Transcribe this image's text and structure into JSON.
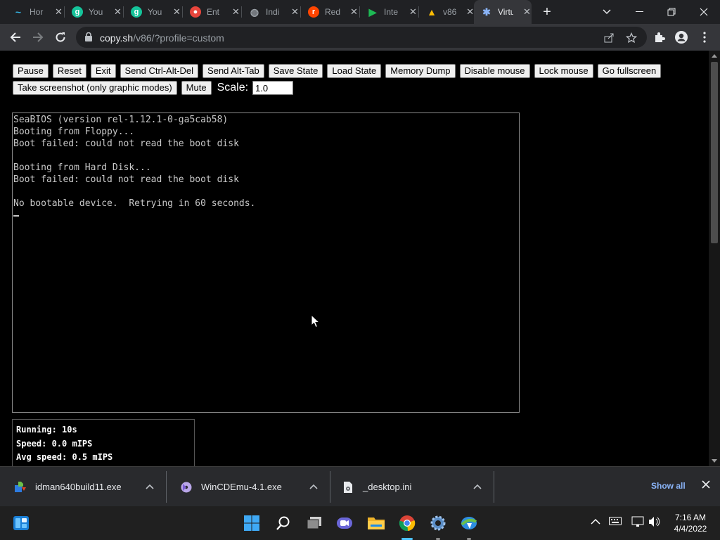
{
  "browser": {
    "tabs": [
      {
        "label": "Hor",
        "icon": "wave-favicon-icon",
        "color": "#35b6e6"
      },
      {
        "label": "You",
        "icon": "grammarly-g-icon",
        "color": "#15c39a"
      },
      {
        "label": "You",
        "icon": "grammarly-g-icon",
        "color": "#15c39a"
      },
      {
        "label": "Ent",
        "icon": "colorful-logo-icon",
        "color": "#e8453c"
      },
      {
        "label": "Indi",
        "icon": "globe-icon",
        "color": "#9aa0a6"
      },
      {
        "label": "Red",
        "icon": "reddit-icon",
        "color": "#ff4500"
      },
      {
        "label": "Inte",
        "icon": "green-flag-icon",
        "color": "#1db954"
      },
      {
        "label": "v86",
        "icon": "google-drive-icon",
        "color": "#fbbc04"
      },
      {
        "label": "Virtu",
        "icon": "v86-logo-icon",
        "color": "#8ab4f8"
      }
    ],
    "new_tab": "+",
    "url_host": "copy.sh",
    "url_path": "/v86/?profile=custom"
  },
  "buttons_row1": [
    "Pause",
    "Reset",
    "Exit",
    "Send Ctrl-Alt-Del",
    "Send Alt-Tab",
    "Save State",
    "Load State",
    "Memory Dump",
    "Disable mouse",
    "Lock mouse",
    "Go fullscreen"
  ],
  "buttons_row2": [
    "Take screenshot (only graphic modes)",
    "Mute"
  ],
  "scale": {
    "label": "Scale:",
    "value": "1.0"
  },
  "console_lines": [
    "SeaBIOS (version rel-1.12.1-0-ga5cab58)",
    "Booting from Floppy...",
    "Boot failed: could not read the boot disk",
    "",
    "Booting from Hard Disk...",
    "Boot failed: could not read the boot disk",
    "",
    "No bootable device.  Retrying in 60 seconds."
  ],
  "stats": [
    "Running: 10s",
    "Speed: 0.0 mIPS",
    "Avg speed: 0.5 mIPS"
  ],
  "downloads": [
    {
      "name": "idman640build11.exe",
      "icon": "idm-installer-icon"
    },
    {
      "name": "WinCDEmu-4.1.exe",
      "icon": "wincdemu-icon"
    },
    {
      "name": "_desktop.ini",
      "icon": "file-settings-icon"
    }
  ],
  "show_all": "Show all",
  "clock": {
    "time": "7:16 AM",
    "date": "4/4/2022"
  }
}
